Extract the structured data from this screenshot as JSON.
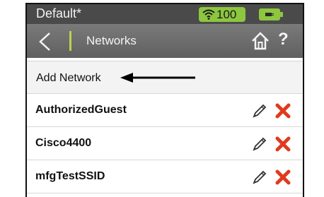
{
  "statusbar": {
    "title": "Default*",
    "wifi_value": "100",
    "wifi_icon": "wifi-icon",
    "battery_icon": "battery-charging-icon",
    "accent_color": "#8dc63f"
  },
  "navbar": {
    "back_icon": "chevron-left-icon",
    "title": "Networks",
    "home_icon": "home-icon",
    "help_label": "?"
  },
  "add_network": {
    "label": "Add Network"
  },
  "networks": [
    {
      "name": "AuthorizedGuest"
    },
    {
      "name": "Cisco4400"
    },
    {
      "name": "mfgTestSSID"
    }
  ],
  "row_actions": {
    "edit_icon": "pencil-icon",
    "delete_icon": "delete-x-icon",
    "delete_color": "#e03a1e"
  }
}
